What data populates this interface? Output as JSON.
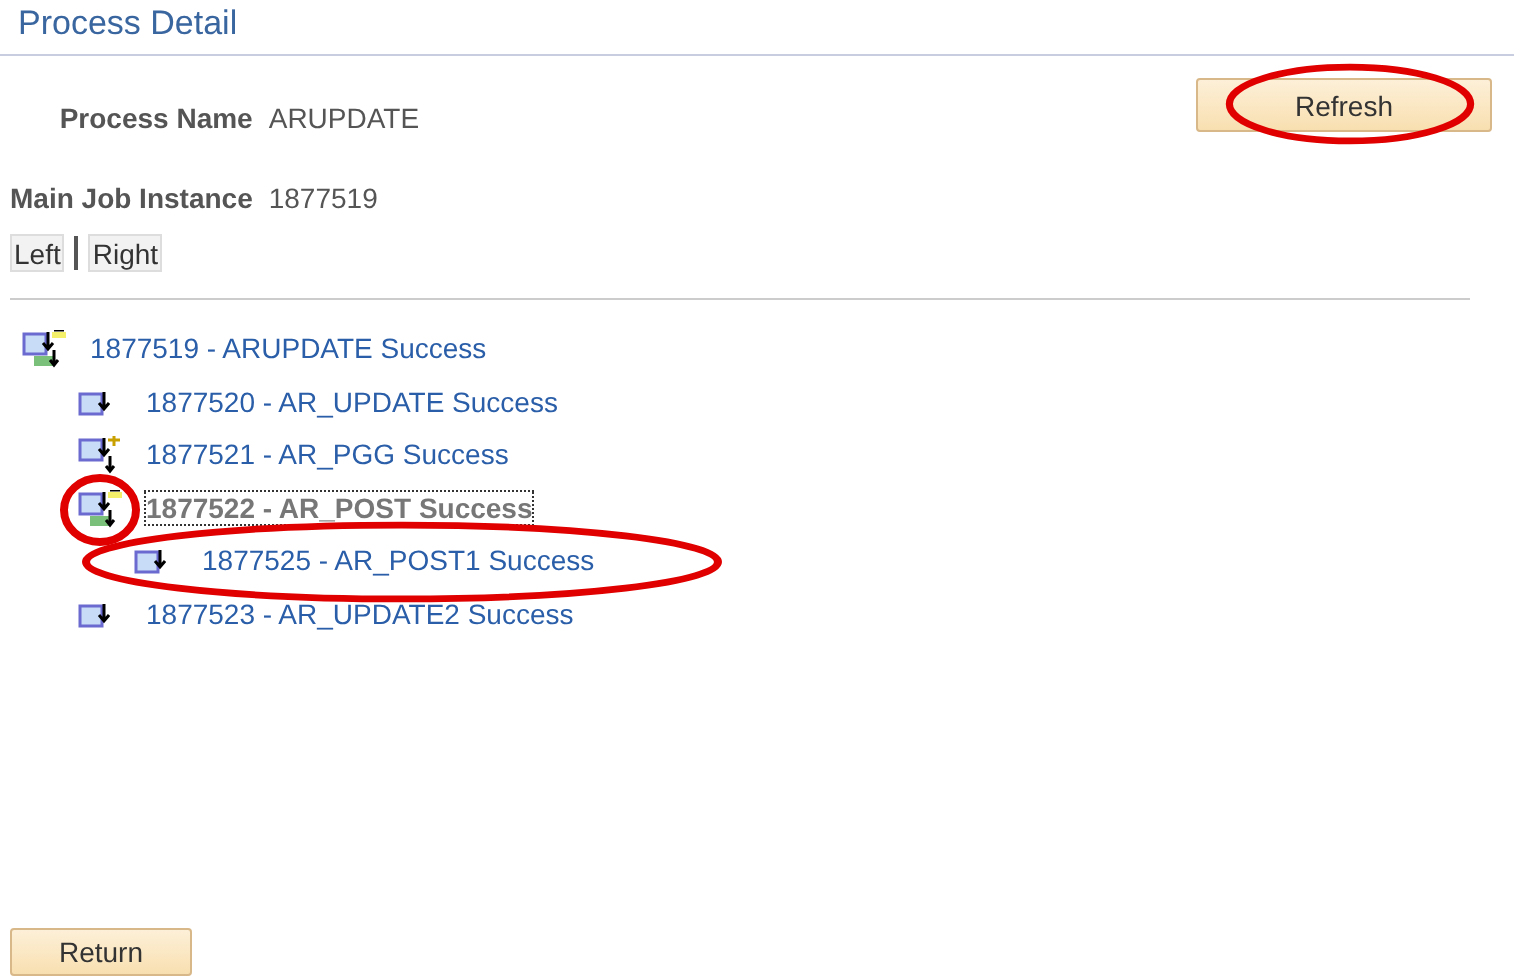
{
  "page_title": "Process Detail",
  "refresh_button": {
    "label": "Refresh",
    "circled": true
  },
  "fields": [
    {
      "label": "Process Name",
      "value": "ARUPDATE"
    },
    {
      "label": "Main Job Instance",
      "value": "1877519"
    }
  ],
  "scroll_buttons": [
    "Left",
    "Right"
  ],
  "tree": [
    {
      "label": "1877519 - ARUPDATE Success",
      "kind": "expanded",
      "selected": false,
      "toggle_circled": false,
      "circled": false,
      "children": [
        {
          "label": "1877520 - AR_UPDATE Success",
          "kind": "leaf",
          "selected": false,
          "toggle_circled": false,
          "circled": false
        },
        {
          "label": "1877521 - AR_PGG Success",
          "kind": "collapsed",
          "selected": false,
          "toggle_circled": false,
          "circled": false
        },
        {
          "label": "1877522 - AR_POST Success",
          "kind": "expanded",
          "selected": true,
          "toggle_circled": true,
          "circled": false,
          "children": [
            {
              "label": "1877525 - AR_POST1 Success",
              "kind": "leaf",
              "selected": false,
              "toggle_circled": false,
              "circled": true
            }
          ]
        },
        {
          "label": "1877523 - AR_UPDATE2 Success",
          "kind": "leaf",
          "selected": false,
          "toggle_circled": false,
          "circled": false
        }
      ]
    }
  ],
  "return_button": {
    "label": "Return"
  }
}
